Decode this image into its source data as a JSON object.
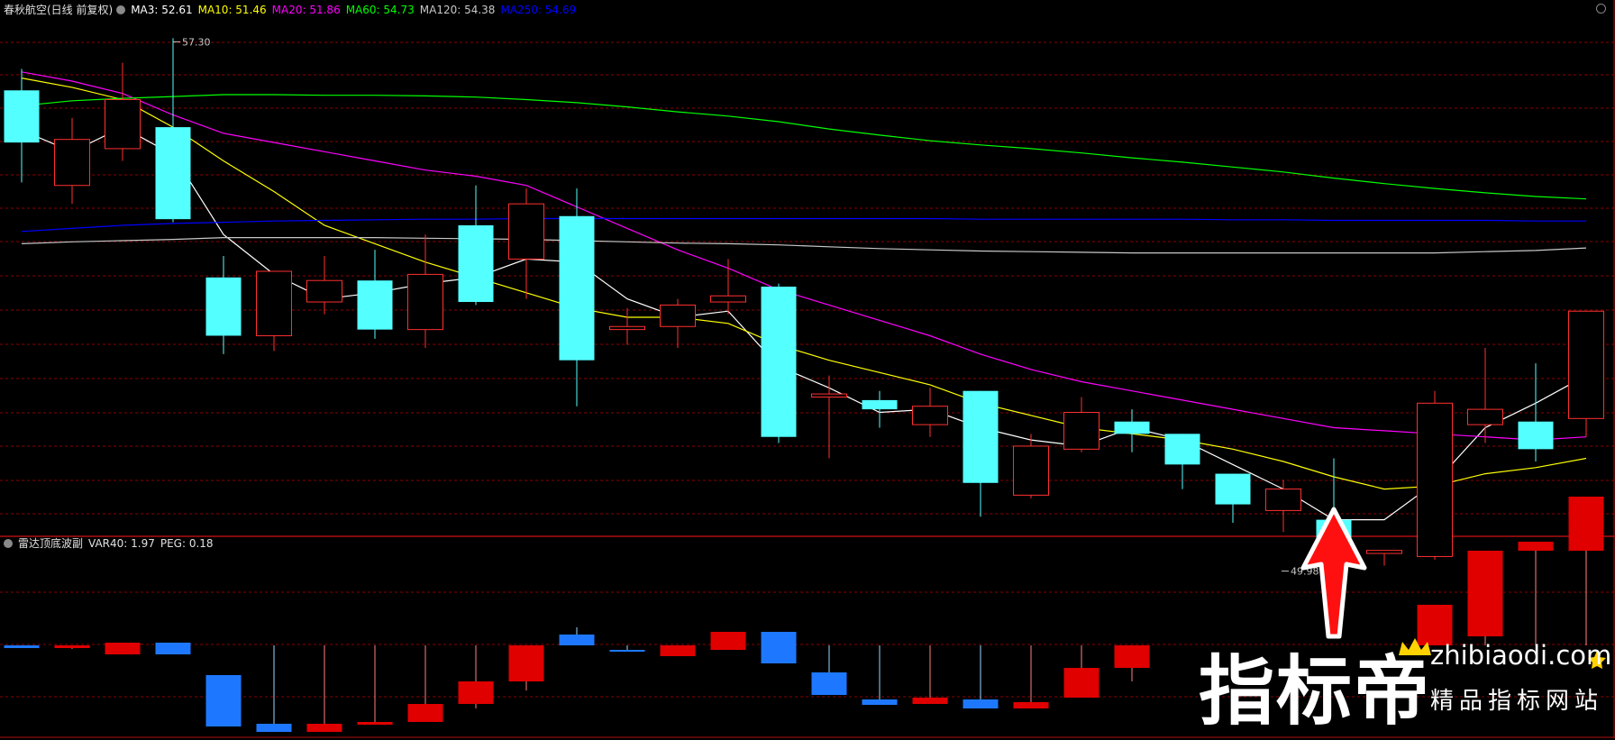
{
  "header": {
    "stock_name": "春秋航空(日线 前复权)",
    "ma_items": [
      {
        "text": "MA3: 52.61",
        "color": "#ffffff"
      },
      {
        "text": "MA10: 51.46",
        "color": "#ffff00"
      },
      {
        "text": "MA20: 51.86",
        "color": "#ff00ff"
      },
      {
        "text": "MA60: 54.73",
        "color": "#00ff00"
      },
      {
        "text": "MA120: 54.38",
        "color": "#c8c8c8"
      },
      {
        "text": "MA250: 54.69",
        "color": "#0000ff"
      }
    ]
  },
  "indicator_header": {
    "name": "雷达顶底波副",
    "var_label": "VAR40: 1.97",
    "peg_label": "PEG: 0.18"
  },
  "watermark": {
    "brand": "指标帝",
    "site": "zhibiaodi.com",
    "tagline": "精品指标网站"
  },
  "colors": {
    "background": "#000000",
    "grid": "#8b0000",
    "up_candle": "#ff3030",
    "down_candle": "#54ffff",
    "osc_up": "#e00000",
    "osc_down": "#1e78ff",
    "arrow": "#ff1010"
  },
  "chart_data": [
    {
      "type": "candlestick",
      "title": "春秋航空(日线 前复权)",
      "ylim": [
        49.4,
        57.6
      ],
      "annotations": [
        {
          "text": "57.30",
          "candle_index": 3,
          "kind": "high"
        },
        {
          "text": "49.98",
          "candle_index": 26,
          "kind": "low"
        }
      ],
      "candles": [
        {
          "o": 56.45,
          "c": 55.6,
          "h": 56.8,
          "l": 54.95
        },
        {
          "o": 54.9,
          "c": 55.65,
          "h": 56.0,
          "l": 54.6
        },
        {
          "o": 55.5,
          "c": 56.3,
          "h": 56.9,
          "l": 55.3
        },
        {
          "o": 55.85,
          "c": 54.35,
          "h": 57.3,
          "l": 54.3
        },
        {
          "o": 53.4,
          "c": 52.45,
          "h": 53.75,
          "l": 52.15
        },
        {
          "o": 52.45,
          "c": 53.5,
          "h": 53.5,
          "l": 52.2
        },
        {
          "o": 53.0,
          "c": 53.35,
          "h": 53.75,
          "l": 52.8
        },
        {
          "o": 53.35,
          "c": 52.55,
          "h": 53.85,
          "l": 52.4
        },
        {
          "o": 52.55,
          "c": 53.45,
          "h": 54.1,
          "l": 52.25
        },
        {
          "o": 54.25,
          "c": 53.0,
          "h": 54.9,
          "l": 52.95
        },
        {
          "o": 53.7,
          "c": 54.6,
          "h": 54.85,
          "l": 53.05
        },
        {
          "o": 54.4,
          "c": 52.05,
          "h": 54.85,
          "l": 51.3
        },
        {
          "o": 52.55,
          "c": 52.6,
          "h": 52.9,
          "l": 52.3
        },
        {
          "o": 52.6,
          "c": 52.95,
          "h": 53.05,
          "l": 52.25
        },
        {
          "o": 53.0,
          "c": 53.1,
          "h": 53.7,
          "l": 52.8
        },
        {
          "o": 53.25,
          "c": 50.8,
          "h": 53.3,
          "l": 50.7
        },
        {
          "o": 51.45,
          "c": 51.5,
          "h": 51.8,
          "l": 50.45
        },
        {
          "o": 51.4,
          "c": 51.25,
          "h": 51.55,
          "l": 50.95
        },
        {
          "o": 51.0,
          "c": 51.3,
          "h": 51.6,
          "l": 50.8
        },
        {
          "o": 51.55,
          "c": 50.05,
          "h": 51.55,
          "l": 49.5
        },
        {
          "o": 49.85,
          "c": 50.65,
          "h": 50.85,
          "l": 49.8
        },
        {
          "o": 50.6,
          "c": 51.2,
          "h": 51.45,
          "l": 50.55
        },
        {
          "o": 51.05,
          "c": 50.85,
          "h": 51.25,
          "l": 50.55
        },
        {
          "o": 50.85,
          "c": 50.35,
          "h": 50.85,
          "l": 49.95
        },
        {
          "o": 50.2,
          "c": 49.7,
          "h": 50.2,
          "l": 49.4
        },
        {
          "o": 49.6,
          "c": 49.95,
          "h": 50.1,
          "l": 49.25
        },
        {
          "o": 49.45,
          "c": 48.75,
          "h": 50.45,
          "l": 48.7
        },
        {
          "o": 48.9,
          "c": 48.95,
          "h": 48.95,
          "l": 48.7
        },
        {
          "o": 48.85,
          "c": 51.35,
          "h": 51.55,
          "l": 48.8
        },
        {
          "o": 51.0,
          "c": 51.25,
          "h": 52.25,
          "l": 50.7
        },
        {
          "o": 51.05,
          "c": 50.6,
          "h": 52.0,
          "l": 50.4
        },
        {
          "o": 51.1,
          "c": 52.85,
          "h": 52.85,
          "l": 50.8
        }
      ],
      "moving_averages": [
        {
          "name": "MA3",
          "color": "#ffffff",
          "values": [
            55.8,
            55.45,
            55.85,
            55.4,
            54.1,
            53.45,
            53.05,
            53.15,
            53.3,
            53.4,
            53.7,
            53.65,
            53.05,
            52.75,
            52.85,
            51.95,
            51.6,
            51.2,
            51.25,
            50.95,
            50.75,
            50.65,
            50.95,
            50.75,
            50.35,
            49.95,
            49.45,
            49.45,
            50.05,
            50.95,
            51.35,
            51.8
          ]
        },
        {
          "name": "MA10",
          "color": "#ffff00",
          "values": [
            56.65,
            56.5,
            56.3,
            55.85,
            55.3,
            54.8,
            54.25,
            53.95,
            53.65,
            53.4,
            53.15,
            52.9,
            52.75,
            52.75,
            52.65,
            52.3,
            52.05,
            51.85,
            51.65,
            51.35,
            51.15,
            50.95,
            50.85,
            50.75,
            50.6,
            50.4,
            50.15,
            49.95,
            50.0,
            50.2,
            50.3,
            50.45
          ]
        },
        {
          "name": "MA20",
          "color": "#ff00ff",
          "values": [
            56.75,
            56.6,
            56.4,
            56.05,
            55.75,
            55.6,
            55.45,
            55.3,
            55.15,
            55.05,
            54.9,
            54.55,
            54.2,
            53.85,
            53.55,
            53.2,
            52.95,
            52.7,
            52.45,
            52.15,
            51.9,
            51.7,
            51.55,
            51.4,
            51.25,
            51.1,
            50.95,
            50.9,
            50.85,
            50.8,
            50.75,
            50.8
          ]
        },
        {
          "name": "MA60",
          "color": "#00ff00",
          "values": [
            56.2,
            56.28,
            56.32,
            56.35,
            56.38,
            56.38,
            56.37,
            56.37,
            56.36,
            56.34,
            56.3,
            56.25,
            56.18,
            56.1,
            56.03,
            55.94,
            55.82,
            55.72,
            55.63,
            55.56,
            55.5,
            55.43,
            55.35,
            55.28,
            55.2,
            55.12,
            55.02,
            54.93,
            54.85,
            54.78,
            54.72,
            54.68
          ]
        },
        {
          "name": "MA120",
          "color": "#c8c8c8",
          "values": [
            53.95,
            53.98,
            54.0,
            54.02,
            54.05,
            54.05,
            54.05,
            54.05,
            54.04,
            54.03,
            54.02,
            54.0,
            53.98,
            53.96,
            53.95,
            53.93,
            53.9,
            53.87,
            53.85,
            53.83,
            53.82,
            53.81,
            53.8,
            53.8,
            53.8,
            53.8,
            53.8,
            53.8,
            53.8,
            53.82,
            53.84,
            53.88
          ]
        },
        {
          "name": "MA250",
          "color": "#0000ff",
          "values": [
            54.15,
            54.2,
            54.25,
            54.28,
            54.3,
            54.32,
            54.33,
            54.34,
            54.35,
            54.35,
            54.36,
            54.36,
            54.36,
            54.36,
            54.36,
            54.36,
            54.36,
            54.36,
            54.36,
            54.35,
            54.35,
            54.35,
            54.35,
            54.35,
            54.34,
            54.34,
            54.33,
            54.33,
            54.33,
            54.33,
            54.32,
            54.32
          ]
        }
      ]
    },
    {
      "type": "bar",
      "title": "雷达顶底波副",
      "ylim": [
        -1.0,
        1.0
      ],
      "bars": [
        {
          "from": 0.0,
          "to": -0.03,
          "color": "down",
          "stem": [
            -0.02,
            0.0
          ]
        },
        {
          "from": 0.0,
          "to": -0.03,
          "color": "up",
          "stem": [
            -0.04,
            0.0
          ]
        },
        {
          "from": 0.03,
          "to": -0.1,
          "color": "up",
          "stem": [
            -0.1,
            0.03
          ]
        },
        {
          "from": 0.03,
          "to": -0.1,
          "color": "down",
          "stem": [
            -0.1,
            0.03
          ]
        },
        {
          "from": -0.33,
          "to": -0.9,
          "color": "down",
          "stem": [
            -0.9,
            -0.33
          ]
        },
        {
          "from": -0.87,
          "to": -0.96,
          "color": "down",
          "stem": [
            -0.96,
            0.0
          ]
        },
        {
          "from": -0.87,
          "to": -0.96,
          "color": "up",
          "stem": [
            -0.96,
            0.0
          ]
        },
        {
          "from": -0.85,
          "to": -0.88,
          "color": "up",
          "stem": [
            -0.88,
            0.0
          ]
        },
        {
          "from": -0.65,
          "to": -0.85,
          "color": "up",
          "stem": [
            -0.85,
            0.0
          ]
        },
        {
          "from": -0.4,
          "to": -0.65,
          "color": "up",
          "stem": [
            -0.7,
            0.0
          ]
        },
        {
          "from": 0.0,
          "to": -0.4,
          "color": "up",
          "stem": [
            -0.5,
            0.0
          ]
        },
        {
          "from": 0.0,
          "to": 0.12,
          "color": "down",
          "stem": [
            0.0,
            0.2
          ]
        },
        {
          "from": -0.05,
          "to": -0.07,
          "color": "down",
          "stem": [
            -0.07,
            0.0
          ]
        },
        {
          "from": 0.0,
          "to": -0.12,
          "color": "up",
          "stem": [
            -0.12,
            0.0
          ]
        },
        {
          "from": 0.15,
          "to": -0.05,
          "color": "up",
          "stem": [
            -0.05,
            0.15
          ]
        },
        {
          "from": 0.15,
          "to": -0.2,
          "color": "down",
          "stem": [
            -0.2,
            0.15
          ]
        },
        {
          "from": -0.3,
          "to": -0.55,
          "color": "down",
          "stem": [
            -0.55,
            0.0
          ]
        },
        {
          "from": -0.6,
          "to": -0.66,
          "color": "down",
          "stem": [
            -0.66,
            0.0
          ]
        },
        {
          "from": -0.58,
          "to": -0.65,
          "color": "up",
          "stem": [
            -0.65,
            0.0
          ]
        },
        {
          "from": -0.6,
          "to": -0.7,
          "color": "down",
          "stem": [
            -0.7,
            0.0
          ]
        },
        {
          "from": -0.63,
          "to": -0.7,
          "color": "up",
          "stem": [
            -0.7,
            0.0
          ]
        },
        {
          "from": -0.25,
          "to": -0.58,
          "color": "up",
          "stem": [
            -0.58,
            0.0
          ]
        },
        {
          "from": 0.0,
          "to": -0.25,
          "color": "up",
          "stem": [
            -0.4,
            0.0
          ]
        },
        {
          "from": 0.0,
          "to": 0.0,
          "color": "up",
          "stem": [
            0.0,
            0.0
          ]
        },
        {
          "from": 0.0,
          "to": 0.0,
          "color": "up",
          "stem": [
            0.0,
            0.0
          ]
        },
        {
          "from": 0.0,
          "to": 0.0,
          "color": "up",
          "stem": [
            0.0,
            0.0
          ]
        },
        {
          "from": 0.0,
          "to": 0.0,
          "color": "up",
          "stem": [
            0.0,
            0.0
          ]
        },
        {
          "from": 0.0,
          "to": 0.0,
          "color": "up",
          "stem": [
            0.0,
            0.0
          ]
        },
        {
          "from": 0.0,
          "to": 0.45,
          "color": "up",
          "stem": [
            0.0,
            0.45
          ]
        },
        {
          "from": 0.1,
          "to": 1.05,
          "color": "up",
          "stem": [
            0.0,
            1.05
          ]
        },
        {
          "from": 1.05,
          "to": 1.15,
          "color": "up",
          "stem": [
            0.0,
            1.15
          ]
        },
        {
          "from": 1.05,
          "to": 1.65,
          "color": "up",
          "stem": [
            0.0,
            1.65
          ]
        }
      ]
    }
  ]
}
